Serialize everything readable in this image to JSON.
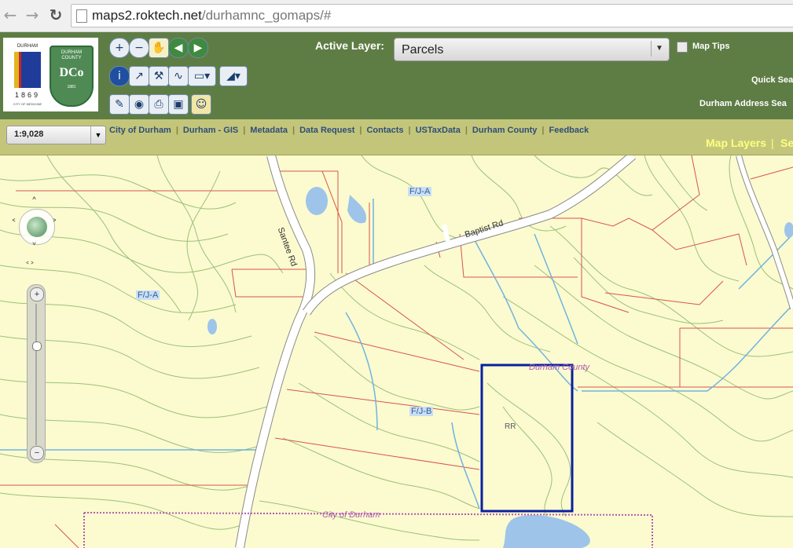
{
  "browser": {
    "url_domain": "maps2.roktech.net",
    "url_path": "/durhamnc_gomaps/#"
  },
  "logos": {
    "city_title": "DURHAM",
    "city_year": "1869",
    "city_tagline": "CITY OF MEDICINE",
    "county_title": "DURHAM COUNTY",
    "county_mark": "DCo",
    "county_year": "1881"
  },
  "header": {
    "active_layer_label": "Active Layer:",
    "active_layer_value": "Parcels",
    "map_tips_label": "Map Tips",
    "map_tips_checked": false,
    "quick_search_label": "Quick Sea",
    "address_search_label": "Durham Address Sea"
  },
  "toolbar": {
    "tools": [
      "zoom-in-icon",
      "zoom-out-icon",
      "pan-hand-icon",
      "back-extent-icon",
      "forward-extent-icon",
      "identify-icon",
      "select-icon",
      "hammer-icon",
      "measure-line-icon",
      "rectangle-select-icon",
      "polygon-select-icon",
      "pencil-icon",
      "globe-layers-icon",
      "print-icon",
      "save-icon",
      "person-icon"
    ]
  },
  "strip": {
    "scale_value": "1:9,028",
    "links": [
      "City of Durham",
      "Durham - GIS",
      "Metadata",
      "Data Request",
      "Contacts",
      "USTaxData",
      "Durham County",
      "Feedback"
    ],
    "map_layers_tab": "Map Layers",
    "search_tab": "Se"
  },
  "map": {
    "labels": {
      "zone_fja_top": "F/J-A",
      "zone_fja_left": "F/J-A",
      "zone_fjb": "F/J-B",
      "road_baptist": "Baptist Rd",
      "road_santee": "Santee Rd",
      "durham_county": "Durham County",
      "rr": "RR",
      "city_of_durham": "City of Durham"
    },
    "colors": {
      "background": "#fbfbcf",
      "contour": "#9dc07a",
      "parcel": "#d9534f",
      "stream": "#6fb3e0",
      "water": "#9ec4ea",
      "road": "#ffffff",
      "selection": "#0a1fa0",
      "city_boundary": "#b35ab3"
    }
  }
}
